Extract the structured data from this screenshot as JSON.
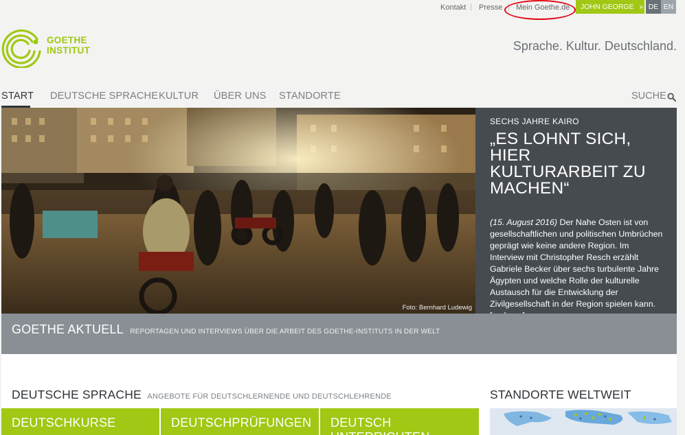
{
  "topbar": {
    "kontakt": "Kontakt",
    "presse": "Presse",
    "separator": "|",
    "mein_goethe": "Mein Goethe.de",
    "user": "JOHN GEORGE",
    "user_chevron": "»",
    "lang_de": "DE",
    "lang_en": "EN"
  },
  "logo": {
    "line1": "GOETHE",
    "line2": "INSTITUT",
    "icon": "goethe-spiral-logo"
  },
  "tagline": "Sprache. Kultur. Deutschland.",
  "nav": {
    "items": [
      "START",
      "DEUTSCHE SPRACHE",
      "KULTUR",
      "ÜBER UNS",
      "STANDORTE"
    ],
    "active": "START",
    "search_label": "SUCHE",
    "search_icon": "search-icon"
  },
  "hero": {
    "photo_credit": "Foto: Bernhard Ludewig",
    "kicker": "SECHS JAHRE KAIRO",
    "title": "„ES LOHNT SICH, HIER KULTURARBEIT ZU MACHEN“",
    "date": "(15. August 2016)",
    "body": " Der Nahe Osten ist von gesellschaftlichen und politischen Umbrüchen geprägt wie keine andere Region. Im Interview mit Christopher Resch erzählt Gabriele Becker über sechs turbulente Jahre Ägypten und welche Rolle der kulturelle Austausch für die Entwicklung der Zivilgesellschaft in der Region spielen kann. ",
    "more": "[mehr …]"
  },
  "aktuell": {
    "title": "GOETHE AKTUELL",
    "subtitle": "REPORTAGEN UND INTERVIEWS ÜBER DIE ARBEIT DES GOETHE-INSTITUTS IN DER WELT"
  },
  "sprache": {
    "title": "DEUTSCHE SPRACHE",
    "subtitle": "ANGEBOTE FÜR DEUTSCHLERNENDE UND DEUTSCHLEHRENDE",
    "tiles": [
      "DEUTSCHKURSE",
      "DEUTSCHPRÜFUNGEN",
      "DEUTSCH UNTERRICHTEN"
    ]
  },
  "standorte": {
    "title": "STANDORTE WELTWEIT"
  },
  "colors": {
    "brand_green": "#a0c814",
    "dark_gray": "#464b50",
    "mid_gray": "#8a8f95",
    "annotation_red": "#e30613"
  }
}
